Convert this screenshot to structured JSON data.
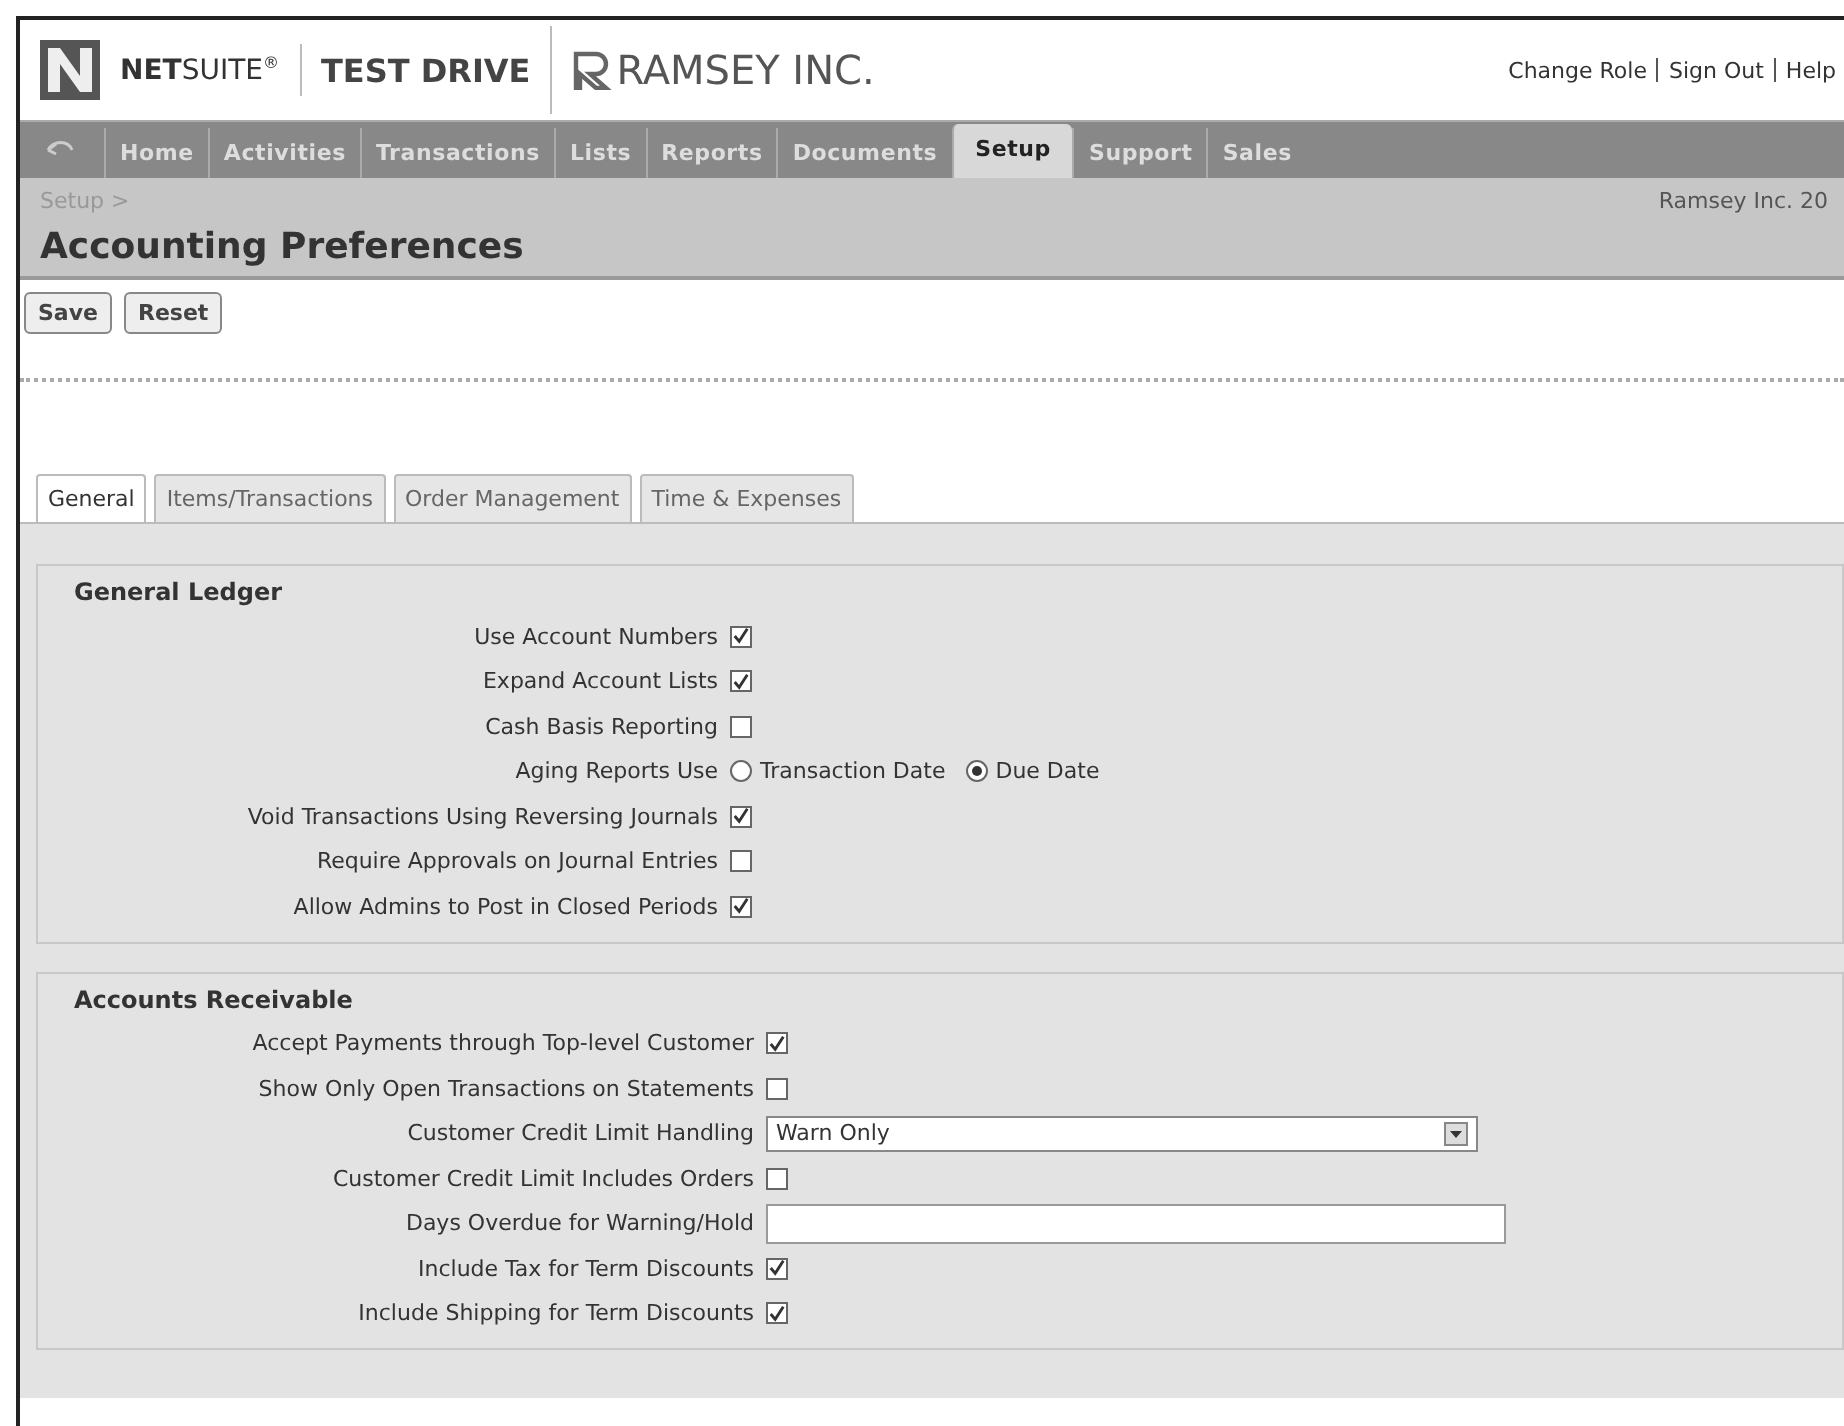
{
  "header": {
    "brand": "NETSUITE",
    "brand_mark": "®",
    "product": "TEST DRIVE",
    "company": "RAMSEY INC.",
    "links": [
      "Change Role",
      "Sign Out",
      "Help"
    ]
  },
  "nav": [
    {
      "label": "Home",
      "selected": false
    },
    {
      "label": "Activities",
      "selected": false
    },
    {
      "label": "Transactions",
      "selected": false
    },
    {
      "label": "Lists",
      "selected": false
    },
    {
      "label": "Reports",
      "selected": false
    },
    {
      "label": "Documents",
      "selected": false
    },
    {
      "label": "Setup",
      "selected": true
    },
    {
      "label": "Support",
      "selected": false
    },
    {
      "label": "Sales",
      "selected": false
    }
  ],
  "breadcrumb": "Setup >",
  "account": "Ramsey Inc. 20",
  "page_title": "Accounting Preferences",
  "buttons": [
    "Save",
    "Reset"
  ],
  "tabs": [
    {
      "label": "General",
      "selected": true
    },
    {
      "label": "Items/Transactions",
      "selected": false
    },
    {
      "label": "Order Management",
      "selected": false
    },
    {
      "label": "Time & Expenses",
      "selected": false
    }
  ],
  "sections": [
    {
      "title": "General Ledger",
      "rows": [
        {
          "kind": "checkbox",
          "label": "Use Account Numbers",
          "checked": true
        },
        {
          "kind": "checkbox",
          "label": "Expand Account Lists",
          "checked": true
        },
        {
          "kind": "checkbox",
          "label": "Cash Basis Reporting",
          "checked": false
        },
        {
          "kind": "radio",
          "label": "Aging Reports Use",
          "options": [
            {
              "label": "Transaction Date",
              "selected": false
            },
            {
              "label": "Due Date",
              "selected": true
            }
          ]
        },
        {
          "kind": "checkbox",
          "label": "Void Transactions Using Reversing Journals",
          "checked": true
        },
        {
          "kind": "checkbox",
          "label": "Require Approvals on Journal Entries",
          "checked": false
        },
        {
          "kind": "checkbox",
          "label": "Allow Admins to Post in Closed Periods",
          "checked": true
        }
      ]
    },
    {
      "title": "Accounts Receivable",
      "rows": [
        {
          "kind": "checkbox",
          "label": "Accept Payments through Top-level Customer",
          "checked": true
        },
        {
          "kind": "checkbox",
          "label": "Show Only Open Transactions on Statements",
          "checked": false
        },
        {
          "kind": "select",
          "label": "Customer Credit Limit Handling",
          "value": "Warn Only"
        },
        {
          "kind": "checkbox",
          "label": "Customer Credit Limit Includes Orders",
          "checked": false
        },
        {
          "kind": "text",
          "label": "Days Overdue for Warning/Hold"
        },
        {
          "kind": "checkbox",
          "label": "Include Tax for Term Discounts",
          "checked": true
        },
        {
          "kind": "checkbox",
          "label": "Include Shipping for Term Discounts",
          "checked": true
        }
      ]
    }
  ]
}
